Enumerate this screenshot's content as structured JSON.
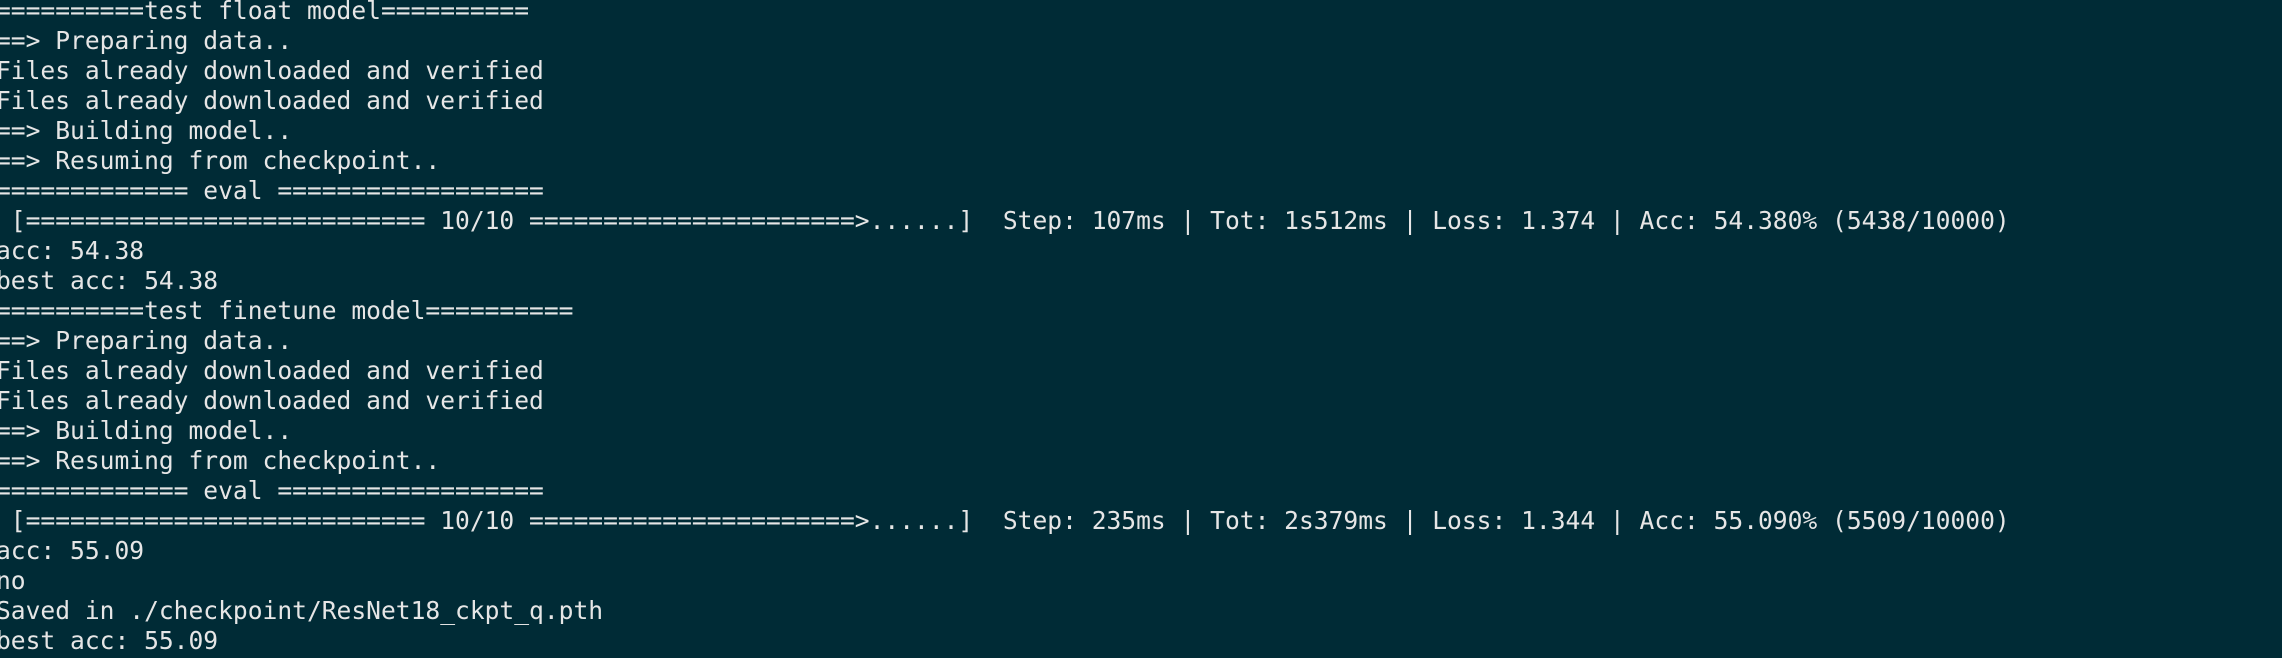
{
  "terminal": {
    "background": "#002b36",
    "foreground": "#e6e6e6",
    "lines": [
      "==========test float model==========",
      "==> Preparing data..",
      "Files already downloaded and verified",
      "Files already downloaded and verified",
      "==> Building model..",
      "==> Resuming from checkpoint..",
      "============= eval ==================",
      " [=========================== 10/10 ======================>......]  Step: 107ms | Tot: 1s512ms | Loss: 1.374 | Acc: 54.380% (5438/10000)",
      "acc: 54.38",
      "best acc: 54.38",
      "==========test finetune model==========",
      "==> Preparing data..",
      "Files already downloaded and verified",
      "Files already downloaded and verified",
      "==> Building model..",
      "==> Resuming from checkpoint..",
      "============= eval ==================",
      " [=========================== 10/10 ======================>......]  Step: 235ms | Tot: 2s379ms | Loss: 1.344 | Acc: 55.090% (5509/10000)",
      "acc: 55.09",
      "no",
      "Saved in ./checkpoint/ResNet18_ckpt_q.pth",
      "best acc: 55.09"
    ]
  }
}
